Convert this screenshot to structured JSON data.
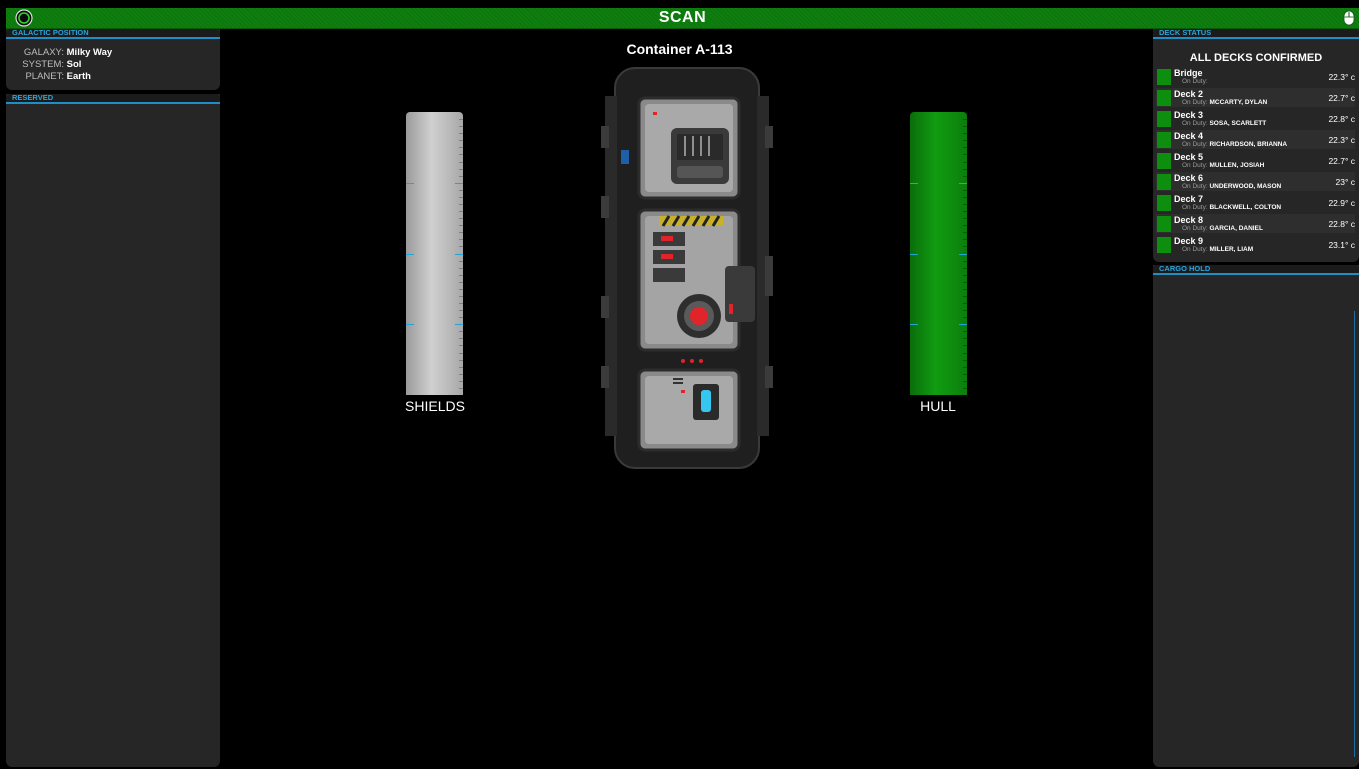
{
  "topbar": {
    "title": "SCAN"
  },
  "galactic_position": {
    "header": "GALACTIC POSITION",
    "rows": [
      {
        "key": "GALAXY:",
        "value": "Milky Way"
      },
      {
        "key": "SYSTEM:",
        "value": "Sol"
      },
      {
        "key": "PLANET:",
        "value": "Earth"
      }
    ]
  },
  "reserved": {
    "header": "RESERVED"
  },
  "scan": {
    "ship_name": "Container A-113",
    "shields_label": "SHIELDS",
    "hull_label": "HULL",
    "shields_level": 1.0,
    "hull_level": 1.0,
    "shields_color": "#c4c4c4",
    "hull_color": "#119c11"
  },
  "deck_status": {
    "header": "DECK STATUS",
    "summary": "ALL DECKS CONFIRMED",
    "on_duty_label": "On Duty:",
    "status_color": "#0e8e0e",
    "decks": [
      {
        "name": "Bridge",
        "crew": "",
        "temp": "22.3° c"
      },
      {
        "name": "Deck 2",
        "crew": "MCCARTY, DYLAN",
        "temp": "22.7° c"
      },
      {
        "name": "Deck 3",
        "crew": "SOSA, SCARLETT",
        "temp": "22.8° c"
      },
      {
        "name": "Deck 4",
        "crew": "RICHARDSON, BRIANNA",
        "temp": "22.3° c"
      },
      {
        "name": "Deck 5",
        "crew": "MULLEN, JOSIAH",
        "temp": "22.7° c"
      },
      {
        "name": "Deck 6",
        "crew": "UNDERWOOD, MASON",
        "temp": "23° c"
      },
      {
        "name": "Deck 7",
        "crew": "BLACKWELL, COLTON",
        "temp": "22.9° c"
      },
      {
        "name": "Deck 8",
        "crew": "GARCIA, DANIEL",
        "temp": "22.8° c"
      },
      {
        "name": "Deck 9",
        "crew": "MILLER, LIAM",
        "temp": "23.1° c"
      }
    ]
  },
  "cargo_hold": {
    "header": "CARGO HOLD"
  },
  "icons": {
    "power": "power-icon",
    "mouse": "mouse-icon"
  }
}
